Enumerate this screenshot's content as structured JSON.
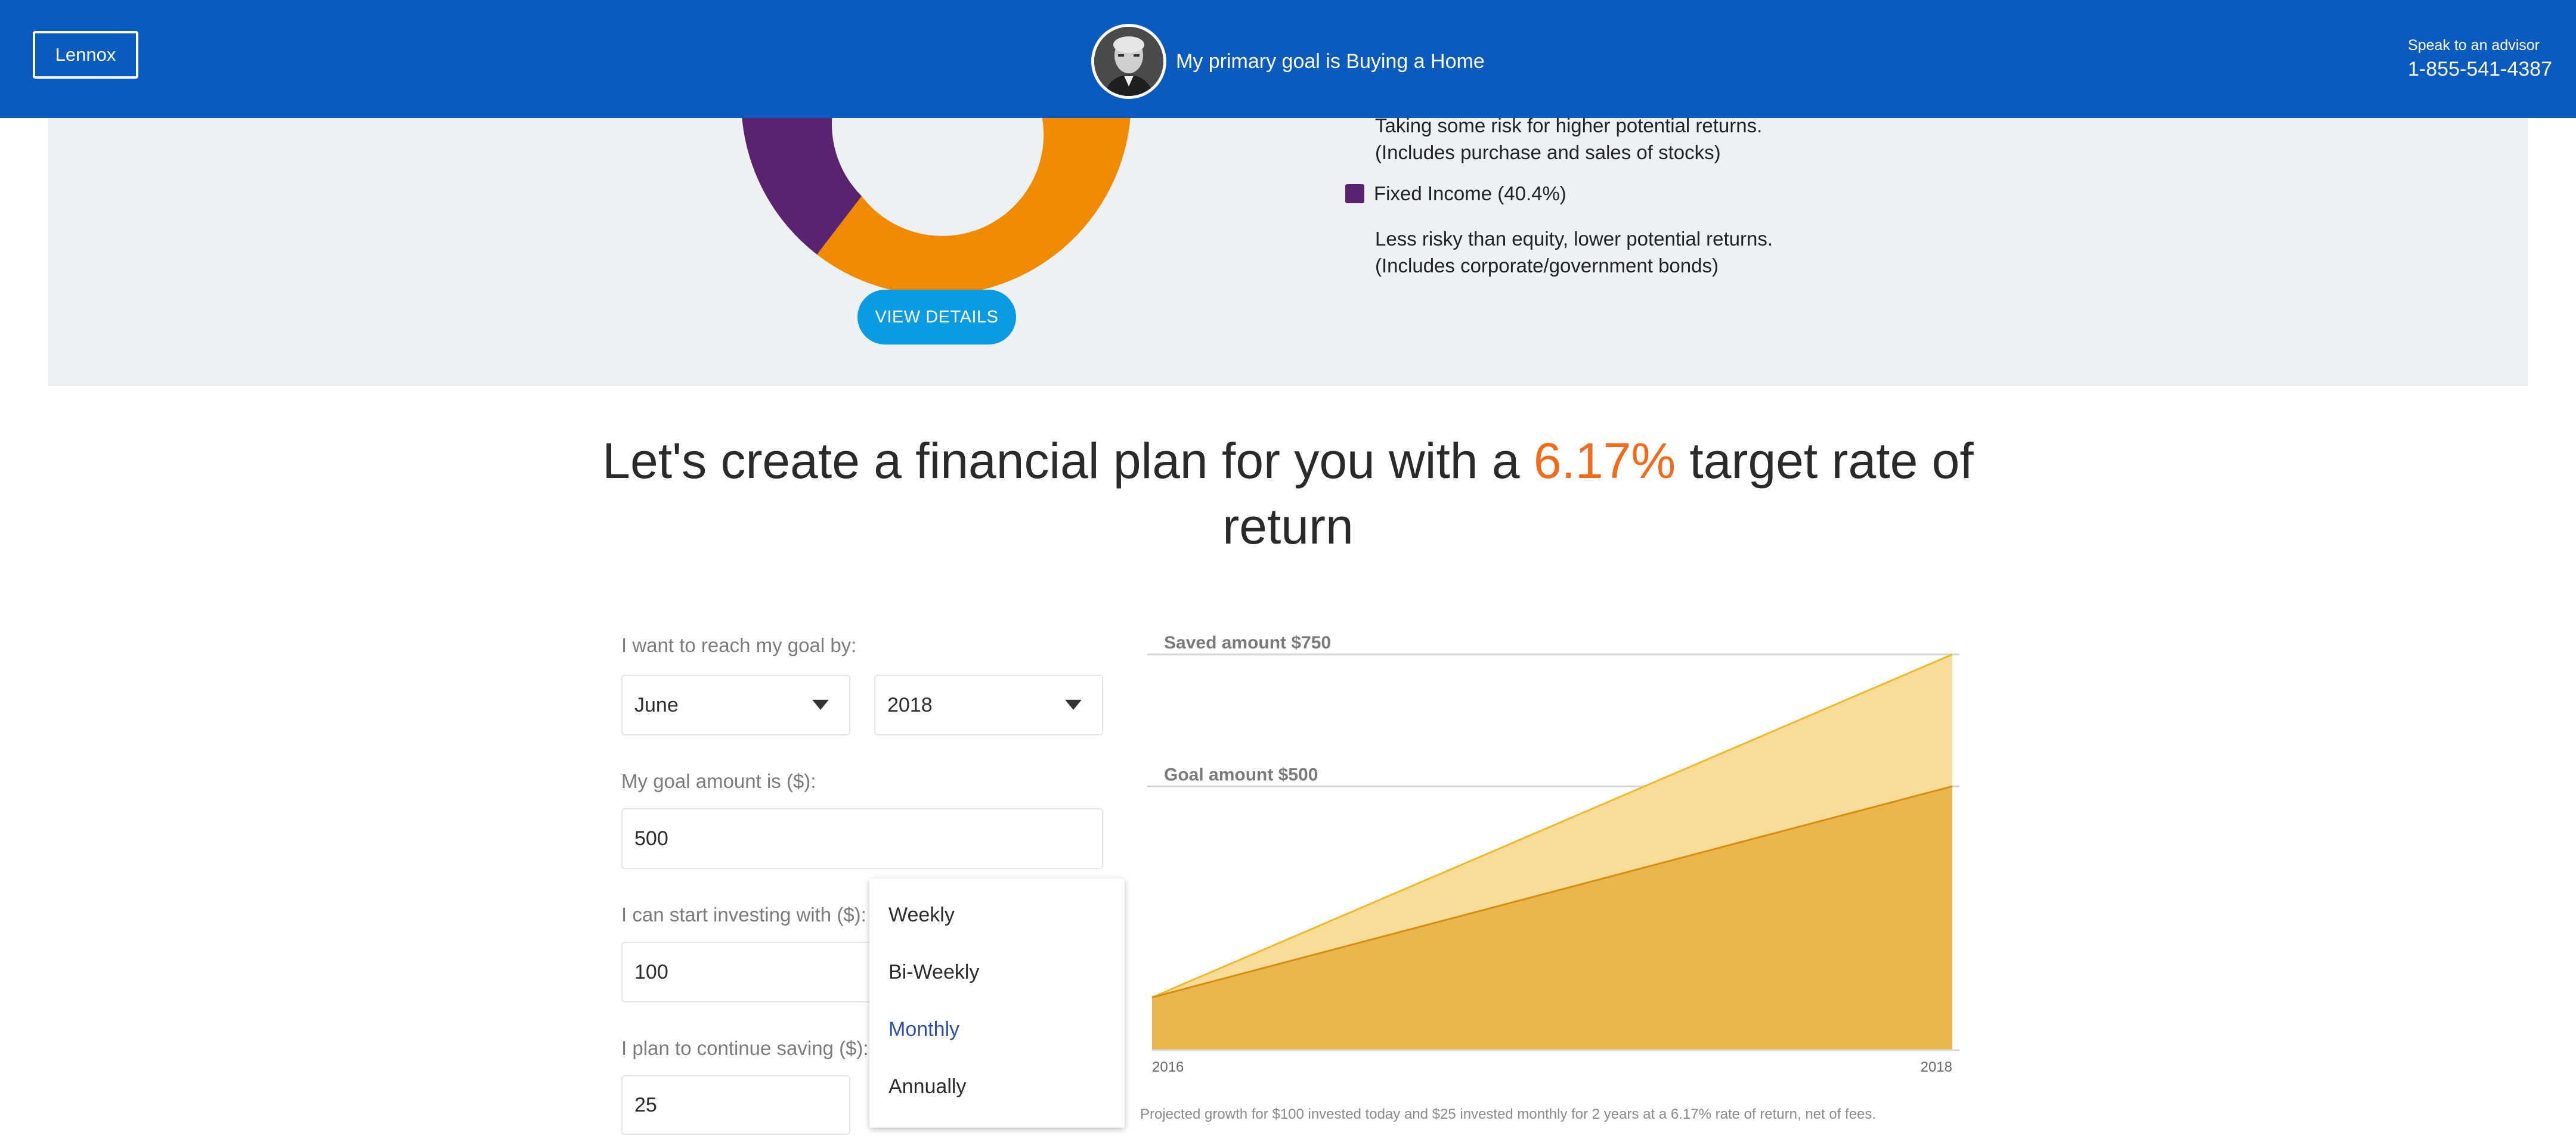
{
  "header": {
    "user_button": "Lennox",
    "goal_text": "My primary goal is Buying a Home",
    "advisor_label": "Speak to an advisor",
    "advisor_phone": "1-855-541-4387"
  },
  "allocation": {
    "equity_desc_line1": "Taking some risk for higher potential returns.",
    "equity_desc_line2": "(Includes purchase and sales of stocks)",
    "fixed_income_label": "Fixed Income (40.4%)",
    "fixed_desc_line1": "Less risky than equity, lower potential returns.",
    "fixed_desc_line2": "(Includes corporate/government bonds)",
    "view_details": "VIEW DETAILS",
    "colors": {
      "equity": "#f08a00",
      "fixed_income": "#5a2370"
    }
  },
  "headline": {
    "before": "Let's create a financial plan for you with a ",
    "rate": "6.17%",
    "after": " target rate of return"
  },
  "form": {
    "goal_by_label": "I want to reach my goal by:",
    "month_value": "June",
    "year_value": "2018",
    "goal_amount_label": "My goal amount is ($):",
    "goal_amount_value": "500",
    "start_label": "I can start investing with ($):",
    "start_value": "100",
    "continue_label": "I plan to continue saving ($):",
    "continue_value": "25"
  },
  "frequency_menu": {
    "options": [
      "Weekly",
      "Bi-Weekly",
      "Monthly",
      "Annually"
    ],
    "selected": "Monthly"
  },
  "chart_data": {
    "type": "area",
    "x": [
      "2016",
      "2018"
    ],
    "series": [
      {
        "name": "Saved amount $750",
        "values": [
          100,
          750
        ],
        "color": "#f9dc97"
      },
      {
        "name": "Goal amount $500",
        "values": [
          100,
          500
        ],
        "color": "#ecb64f"
      }
    ],
    "ylim": [
      0,
      750
    ],
    "annotations": [
      "Saved amount $750",
      "Goal amount $500"
    ],
    "footnote": "Projected growth for $100 invested today and $25 invested monthly for 2 years at a 6.17% rate of return, net of fees."
  }
}
